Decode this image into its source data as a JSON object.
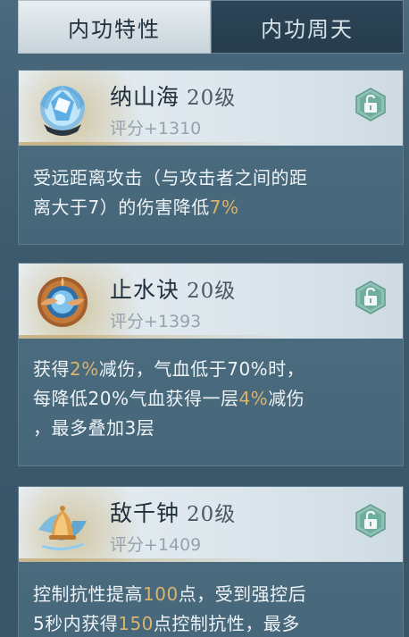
{
  "tabs": [
    {
      "label": "内功特性",
      "active": true
    },
    {
      "label": "内功周天",
      "active": false
    }
  ],
  "skills": [
    {
      "name": "纳山海",
      "level": "20级",
      "score": "评分+1310",
      "icon": "blue-crystal-orb-icon",
      "desc": {
        "line1": "受远距离攻击（与攻击者之间的距",
        "line2_a": "离大于7）的伤害降低",
        "line2_hl": "7%"
      }
    },
    {
      "name": "止水诀",
      "level": "20级",
      "score": "评分+1393",
      "icon": "water-orb-ring-icon",
      "desc": {
        "l1_a": "获得",
        "l1_hl": "2%",
        "l1_b": "减伤，气血低于70%时，",
        "l2_a": "每降低20%气血获得一层",
        "l2_hl": "4%",
        "l2_b": "减伤",
        "l3": "，最多叠加3层"
      }
    },
    {
      "name": "敌千钟",
      "level": "20级",
      "score": "评分+1409",
      "icon": "golden-bell-icon",
      "desc": {
        "l1_a": "控制抗性提高",
        "l1_hl": "100",
        "l1_b": "点，受到强控后",
        "l2_a": "5秒内获得",
        "l2_hl": "150",
        "l2_b": "点控制抗性，最多"
      }
    }
  ],
  "colors": {
    "highlight": "#d8b46e",
    "lock": "#7fb3a3"
  }
}
